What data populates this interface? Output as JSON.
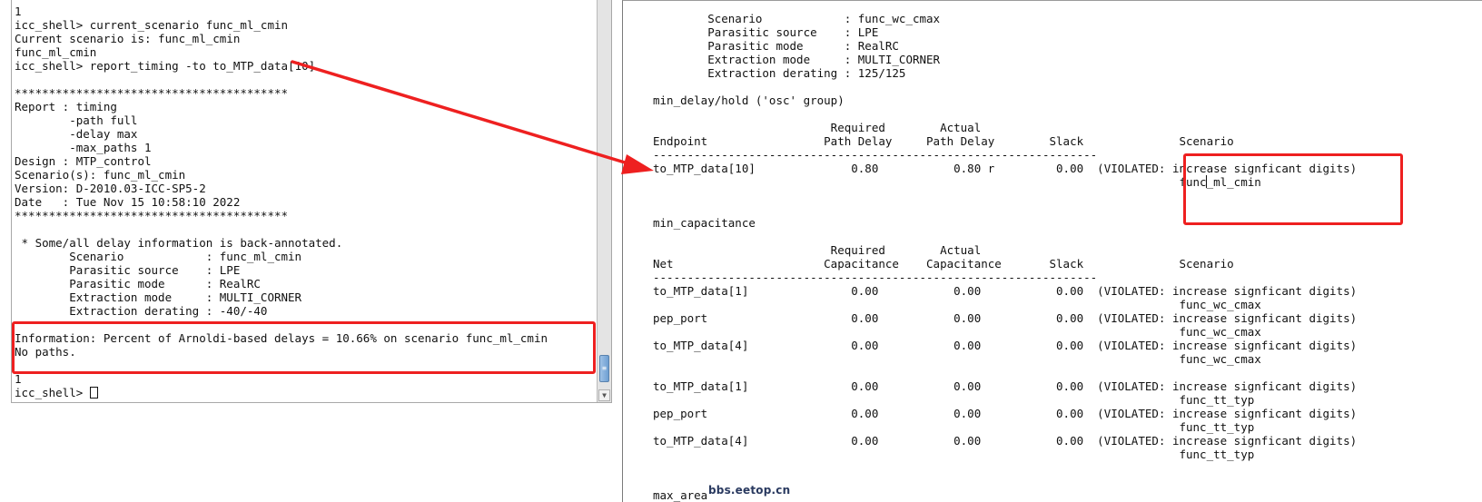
{
  "left_terminal": {
    "lines": [
      "1",
      "icc_shell> current_scenario func_ml_cmin",
      "Current scenario is: func_ml_cmin",
      "func_ml_cmin",
      "icc_shell> report_timing -to to_MTP_data[10]",
      "",
      "****************************************",
      "Report : timing",
      "        -path full",
      "        -delay max",
      "        -max_paths 1",
      "Design : MTP_control",
      "Scenario(s): func_ml_cmin",
      "Version: D-2010.03-ICC-SP5-2",
      "Date   : Tue Nov 15 10:58:10 2022",
      "****************************************",
      "",
      " * Some/all delay information is back-annotated.",
      "        Scenario            : func_ml_cmin",
      "        Parasitic source    : LPE",
      "        Parasitic mode      : RealRC",
      "        Extraction mode     : MULTI_CORNER",
      "        Extraction derating : -40/-40",
      "",
      "Information: Percent of Arnoldi-based delays = 10.66% on scenario func_ml_cmin",
      "No paths.",
      "",
      "1"
    ],
    "prompt": "icc_shell> "
  },
  "right_report": {
    "lines": [
      "        Scenario            : func_wc_cmax",
      "        Parasitic source    : LPE",
      "        Parasitic mode      : RealRC",
      "        Extraction mode     : MULTI_CORNER",
      "        Extraction derating : 125/125",
      "",
      "min_delay/hold ('osc' group)",
      "",
      "                          Required        Actual",
      "Endpoint                 Path Delay     Path Delay        Slack              Scenario",
      "-----------------------------------------------------------------",
      "to_MTP_data[10]              0.80           0.80 r         0.00  (VIOLATED: increase signficant digits)",
      "                                                                             func_ml_cmin",
      "",
      "",
      "min_capacitance",
      "",
      "                          Required        Actual",
      "Net                      Capacitance    Capacitance       Slack              Scenario",
      "-----------------------------------------------------------------",
      "to_MTP_data[1]               0.00           0.00           0.00  (VIOLATED: increase signficant digits)",
      "                                                                             func_wc_cmax",
      "pep_port                     0.00           0.00           0.00  (VIOLATED: increase signficant digits)",
      "                                                                             func_wc_cmax",
      "to_MTP_data[4]               0.00           0.00           0.00  (VIOLATED: increase signficant digits)",
      "                                                                             func_wc_cmax",
      "",
      "to_MTP_data[1]               0.00           0.00           0.00  (VIOLATED: increase signficant digits)",
      "                                                                             func_tt_typ",
      "pep_port                     0.00           0.00           0.00  (VIOLATED: increase signficant digits)",
      "                                                                             func_tt_typ",
      "to_MTP_data[4]               0.00           0.00           0.00  (VIOLATED: increase signficant digits)",
      "                                                                             func_tt_typ",
      "",
      "",
      "max_area"
    ]
  },
  "watermark": "bbs.eetop.cn",
  "colors": {
    "annotation": "#ee2020",
    "scroll_thumb": "#7aa8d8"
  },
  "icons": {
    "scroll_thumb": "grip-lines-icon",
    "scroll_down": "chevron-down-icon",
    "annotation": "red-arrow-icon"
  }
}
